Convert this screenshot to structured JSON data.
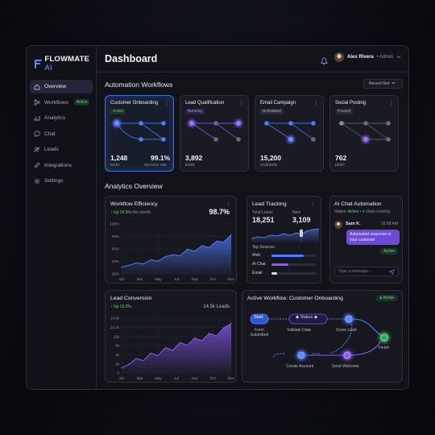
{
  "brand": {
    "name": "FLOWMATE",
    "suffix": "AI"
  },
  "nav": [
    {
      "label": "Overview",
      "icon": "home-icon",
      "active": true
    },
    {
      "label": "Workflows",
      "icon": "workflow-icon",
      "badge": "Active"
    },
    {
      "label": "Analytics",
      "icon": "analytics-icon"
    },
    {
      "label": "Chat",
      "icon": "chat-icon"
    },
    {
      "label": "Leads",
      "icon": "users-icon"
    },
    {
      "label": "Integrations",
      "icon": "link-icon"
    },
    {
      "label": "Settings",
      "icon": "gear-icon"
    }
  ],
  "header": {
    "title": "Dashboard",
    "user_name": "Alex Rivera",
    "user_role": "• Admin"
  },
  "automation": {
    "title": "Automation Workflows",
    "sort": "Recent first",
    "cards": [
      {
        "title": "Customer Onboarding",
        "status": "Active",
        "num1": "1,248",
        "sub1": "tasks",
        "num2": "99.1%",
        "sub2": "success rate"
      },
      {
        "title": "Lead Qualification",
        "status": "Running",
        "num1": "3,892",
        "sub1": "leads"
      },
      {
        "title": "Email Campaign",
        "status": "Scheduled",
        "num1": "15,200",
        "sub1": "recipients"
      },
      {
        "title": "Social Posting",
        "status": "Paused",
        "num1": "762",
        "sub1": "posts"
      }
    ]
  },
  "analytics": {
    "title": "Analytics Overview"
  },
  "efficiency": {
    "title": "Workflow Efficiency",
    "change": "↑ Up 34.5%",
    "period": "this month",
    "value": "98.7%",
    "chart_data": {
      "type": "area",
      "x": [
        "Jan",
        "Mar",
        "May",
        "Jul",
        "Sep",
        "Oct",
        "Dec"
      ],
      "yticks": [
        "100%",
        "80%",
        "60%",
        "40%",
        "20%"
      ],
      "ylim": [
        0,
        110
      ],
      "values": [
        15,
        19,
        24,
        22,
        31,
        28,
        38,
        42,
        40,
        54,
        50,
        62,
        58,
        72,
        70,
        86
      ]
    }
  },
  "lead_tracking": {
    "title": "Lead Tracking",
    "total_label": "Total Leads",
    "total": "18,251",
    "new_label": "New",
    "new": "3,109",
    "sources_title": "Top Sources:",
    "sources": [
      {
        "name": "Web",
        "value": 0.72,
        "color": "#4f7cff"
      },
      {
        "name": "AI Chat",
        "value": 0.38,
        "color": "#8a5cf6"
      },
      {
        "name": "Email",
        "value": 0.12,
        "color": "#d9dbe6"
      }
    ]
  },
  "chat": {
    "title": "AI Chat Automation",
    "status_label": "Status:",
    "status": "Active",
    "running": "• 4 chats running",
    "sender": "Sam K.",
    "time": "10:58 AM",
    "message": "Automated response in your customer",
    "badge": "Active",
    "placeholder": "Type a message..."
  },
  "conversion": {
    "title": "Lead Conversion",
    "change": "↑ Up 19.2%",
    "value": "14.5k Leads",
    "chart_data": {
      "type": "area",
      "x": [
        "Jan",
        "Mar",
        "May",
        "Jul",
        "Sep",
        "Oct",
        "Dec"
      ],
      "yticks": [
        "14.5k",
        "12.2k",
        "10k",
        "8k",
        "4k",
        "2k",
        "0"
      ],
      "ylim": [
        0,
        16
      ],
      "values": [
        1.5,
        2.5,
        4.2,
        3.6,
        5.8,
        5.1,
        7.4,
        6.6,
        8.9,
        8.1,
        10.2,
        9.4,
        11.6,
        10.8,
        13.2,
        14.5
      ]
    }
  },
  "active_workflow": {
    "title": "Active Workflow: Customer Onboarding",
    "badge": "Active",
    "nodes": {
      "start": "Start",
      "form": "Form Submitted",
      "status": "Status",
      "validate": "Validate Data",
      "score": "Score Lead",
      "finish": "Finish",
      "create": "Create Account",
      "welcome": "Send Welcome"
    }
  },
  "colors": {
    "accent_blue": "#4f7cff",
    "accent_purple": "#8a5cf6",
    "green": "#5fd47a"
  }
}
